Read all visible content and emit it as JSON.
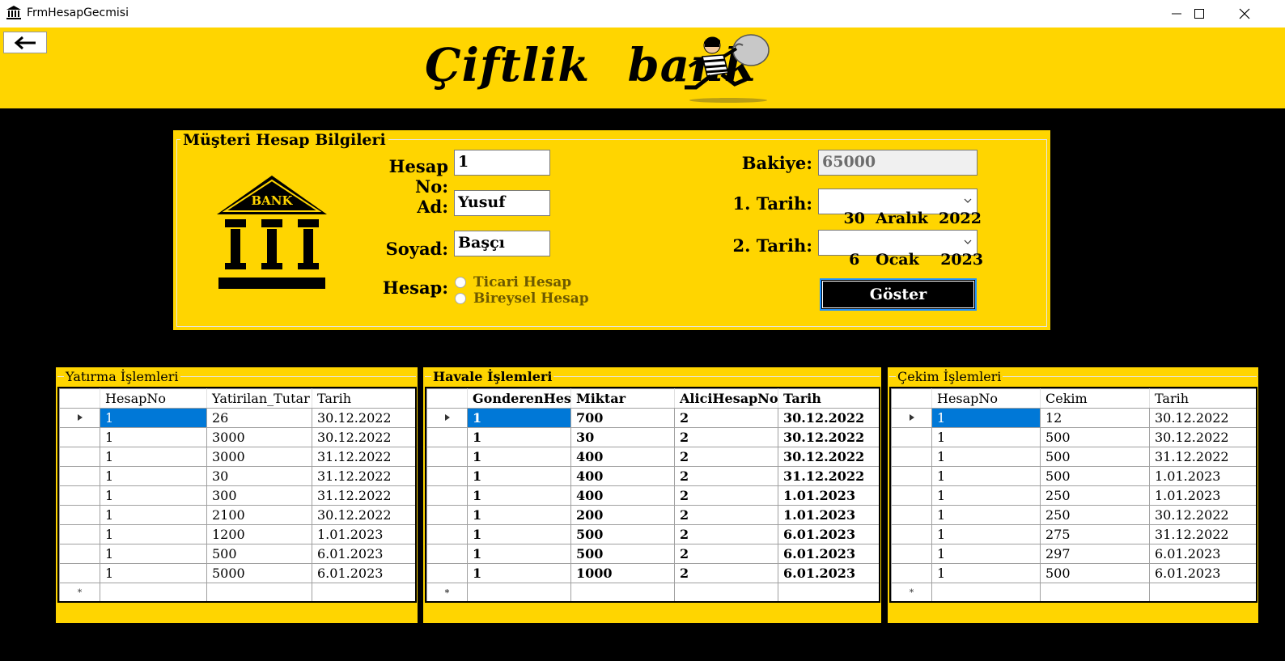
{
  "window": {
    "title": "FrmHesapGecmisi"
  },
  "header": {
    "logo_text": "Çiftlik bank"
  },
  "info_panel": {
    "legend": "Müşteri Hesap Bilgileri",
    "bank_icon_text": "BANK",
    "hesap_no_label": "Hesap No:",
    "hesap_no_value": "1",
    "ad_label": "Ad:",
    "ad_value": "Yusuf",
    "soyad_label": "Soyad:",
    "soyad_value": "Başçı",
    "hesap_label": "Hesap:",
    "radio_ticari": "Ticari Hesap",
    "radio_bireysel": "Bireysel Hesap",
    "bakiye_label": "Bakiye:",
    "bakiye_value": "65000",
    "tarih1_label": "1. Tarih:",
    "tarih1_value": "30  Aralık  2022",
    "tarih2_label": "2. Tarih:",
    "tarih2_value": " 6   Ocak    2023",
    "goster_label": "Göster"
  },
  "yatirma": {
    "legend": "Yatırma İşlemleri",
    "columns": [
      "HesapNo",
      "Yatirilan_Tutar",
      "Tarih"
    ],
    "rows": [
      [
        "1",
        "26",
        "30.12.2022"
      ],
      [
        "1",
        "3000",
        "30.12.2022"
      ],
      [
        "1",
        "3000",
        "31.12.2022"
      ],
      [
        "1",
        "30",
        "31.12.2022"
      ],
      [
        "1",
        "300",
        "31.12.2022"
      ],
      [
        "1",
        "2100",
        "30.12.2022"
      ],
      [
        "1",
        "1200",
        "1.01.2023"
      ],
      [
        "1",
        "500",
        "6.01.2023"
      ],
      [
        "1",
        "5000",
        "6.01.2023"
      ]
    ],
    "new_row_marker": "*"
  },
  "havale": {
    "legend": "Havale İşlemleri",
    "columns": [
      "GonderenHesapNo",
      "Miktar",
      "AliciHesapNo",
      "Tarih"
    ],
    "rows": [
      [
        "1",
        "700",
        "2",
        "30.12.2022"
      ],
      [
        "1",
        "30",
        "2",
        "30.12.2022"
      ],
      [
        "1",
        "400",
        "2",
        "30.12.2022"
      ],
      [
        "1",
        "400",
        "2",
        "31.12.2022"
      ],
      [
        "1",
        "400",
        "2",
        "1.01.2023"
      ],
      [
        "1",
        "200",
        "2",
        "1.01.2023"
      ],
      [
        "1",
        "500",
        "2",
        "6.01.2023"
      ],
      [
        "1",
        "500",
        "2",
        "6.01.2023"
      ],
      [
        "1",
        "1000",
        "2",
        "6.01.2023"
      ]
    ],
    "new_row_marker": "*"
  },
  "cekim": {
    "legend": "Çekim İşlemleri",
    "columns": [
      "HesapNo",
      "Cekim",
      "Tarih"
    ],
    "rows": [
      [
        "1",
        "12",
        "30.12.2022"
      ],
      [
        "1",
        "500",
        "30.12.2022"
      ],
      [
        "1",
        "500",
        "31.12.2022"
      ],
      [
        "1",
        "500",
        "1.01.2023"
      ],
      [
        "1",
        "250",
        "1.01.2023"
      ],
      [
        "1",
        "250",
        "30.12.2022"
      ],
      [
        "1",
        "275",
        "31.12.2022"
      ],
      [
        "1",
        "297",
        "6.01.2023"
      ],
      [
        "1",
        "500",
        "6.01.2023"
      ]
    ],
    "new_row_marker": "*"
  },
  "colors": {
    "accent_yellow": "#FFD500",
    "selection_blue": "#0078D7",
    "background": "#000000"
  },
  "icons": [
    "bank-app-icon",
    "minimize-icon",
    "maximize-icon",
    "close-icon",
    "back-arrow-icon",
    "thief-icon",
    "bank-building-icon",
    "chevron-down-icon",
    "row-pointer-icon"
  ]
}
